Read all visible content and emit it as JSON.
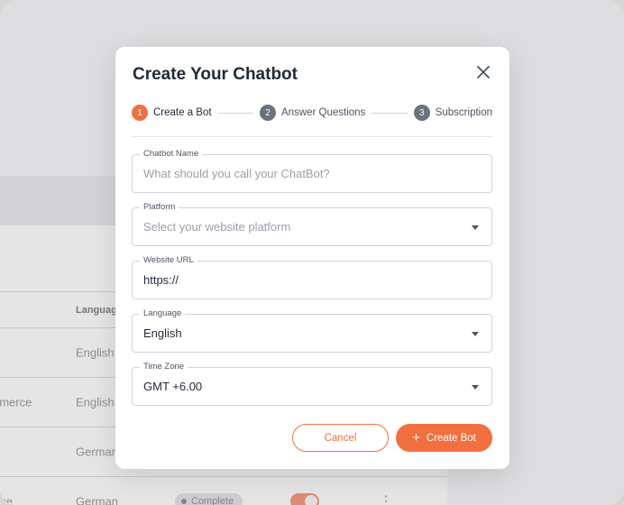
{
  "background": {
    "table": {
      "headers": [
        "Language"
      ],
      "rows": [
        {
          "type": "",
          "language": "English"
        },
        {
          "type": "nmerce",
          "language": "English"
        },
        {
          "type": "",
          "language": "German"
        },
        {
          "type": "rce",
          "language": "German",
          "status": "Complete"
        }
      ]
    }
  },
  "modal": {
    "title": "Create Your Chatbot",
    "close_icon": "close-icon",
    "steps": [
      {
        "number": "1",
        "label": "Create a Bot",
        "active": true
      },
      {
        "number": "2",
        "label": "Answer Questions",
        "active": false
      },
      {
        "number": "3",
        "label": "Subscription",
        "active": false
      }
    ],
    "fields": {
      "chatbot_name": {
        "label": "Chatbot Name",
        "value": "",
        "placeholder": "What should you call your ChatBot?"
      },
      "platform": {
        "label": "Platform",
        "value": "",
        "placeholder": "Select your website platform"
      },
      "website_url": {
        "label": "Website URL",
        "value": "https://"
      },
      "language": {
        "label": "Language",
        "value": "English"
      },
      "time_zone": {
        "label": "Time Zone",
        "value": "GMT +6.00"
      }
    },
    "buttons": {
      "cancel": "Cancel",
      "create": "Create Bot",
      "create_icon": "+"
    }
  },
  "colors": {
    "accent": "#f2703f",
    "step_inactive": "#6b7280",
    "title": "#1f2a37"
  }
}
